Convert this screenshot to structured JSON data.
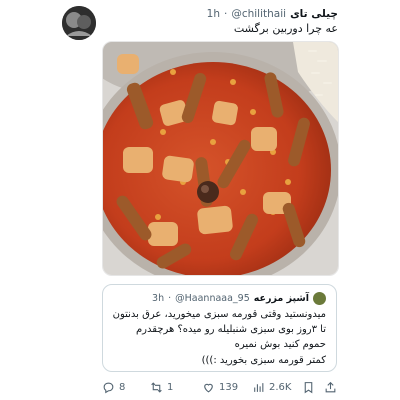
{
  "tweet": {
    "author_name": "چیلی تای",
    "author_handle": "@chilithaii",
    "dot": "·",
    "time": "1h",
    "text": "عه چرا دوربین برگشت"
  },
  "quote": {
    "author_name": "آشپز مزرعه",
    "author_handle": "@Haannaaa_95",
    "dot": "·",
    "time": "3h",
    "lines": [
      "میدونستید وقتی قورمه سبزی میخورید، عرق بدنتون",
      "تا ۳روز بوی سبزی شنبلیله رو میده؟ هرچقدرم",
      "حموم کنید بوش نمیره",
      "کمتر قورمه سبزی بخورید :)))"
    ]
  },
  "actions": {
    "replies": "8",
    "retweets": "1",
    "likes": "139",
    "views": "2.6K"
  },
  "icons": {
    "reply": "reply-icon",
    "retweet": "retweet-icon",
    "like": "heart-icon",
    "views": "views-chart-icon",
    "bookmark": "bookmark-icon",
    "share": "share-icon"
  },
  "colors": {
    "text": "#0f1419",
    "muted": "#536471",
    "border": "#cfd9de",
    "stew": "#c9411f"
  }
}
